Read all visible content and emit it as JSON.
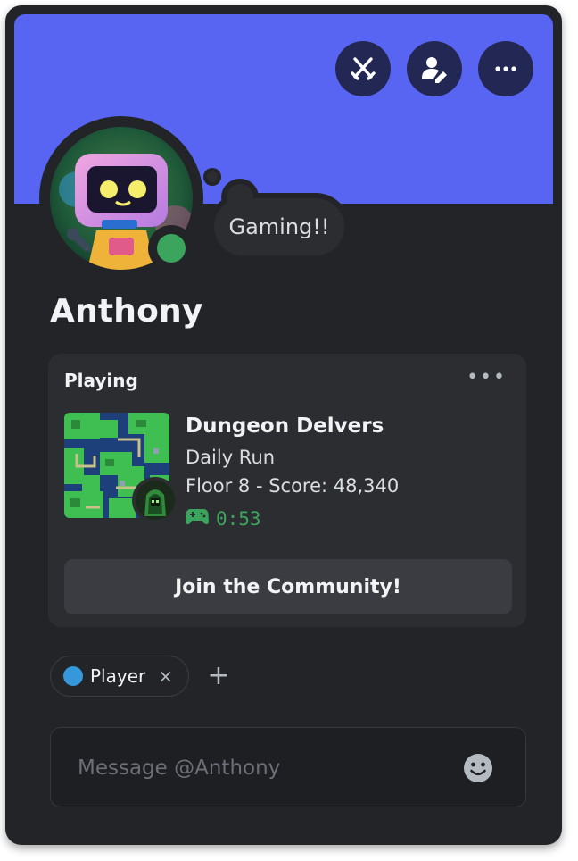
{
  "profile": {
    "username": "Anthony",
    "custom_status": "Gaming!!",
    "status_color": "#3ba55d",
    "banner_color": "#5865f2"
  },
  "header_buttons": [
    {
      "name": "pvp-icon"
    },
    {
      "name": "edit-profile-icon"
    },
    {
      "name": "more-icon"
    }
  ],
  "activity": {
    "header": "Playing",
    "more_label": "•••",
    "game_title": "Dungeon Delvers",
    "details": "Daily Run",
    "state": "Floor 8 - Score: 48,340",
    "elapsed": "0:53",
    "join_label": "Join the Community!"
  },
  "roles": [
    {
      "label": "Player",
      "color": "#3498db",
      "remove": "×"
    }
  ],
  "add_role_label": "+",
  "message": {
    "placeholder": "Message @Anthony"
  }
}
